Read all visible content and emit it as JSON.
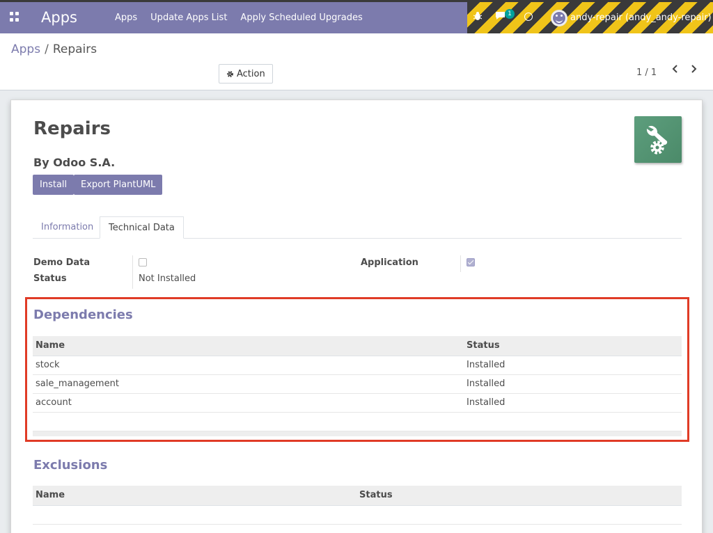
{
  "navbar": {
    "brand": "Apps",
    "menu": [
      "Apps",
      "Update Apps List",
      "Apply Scheduled Upgrades"
    ],
    "chat_badge": "1",
    "user": "andy-repair (andy_andy-repair)"
  },
  "breadcrumb": {
    "parent": "Apps",
    "separator": "/",
    "current": "Repairs"
  },
  "toolbar": {
    "action_label": "Action"
  },
  "pager": {
    "value": "1 / 1"
  },
  "app": {
    "title": "Repairs",
    "author": "By Odoo S.A.",
    "install_label": "Install",
    "export_label": "Export PlantUML"
  },
  "tabs": [
    "Information",
    "Technical Data"
  ],
  "fields": {
    "demo_data_label": "Demo Data",
    "demo_data_checked": false,
    "status_label": "Status",
    "status_value": "Not Installed",
    "application_label": "Application",
    "application_checked": true
  },
  "dependencies": {
    "title": "Dependencies",
    "columns": [
      "Name",
      "Status"
    ],
    "rows": [
      {
        "name": "stock",
        "status": "Installed"
      },
      {
        "name": "sale_management",
        "status": "Installed"
      },
      {
        "name": "account",
        "status": "Installed"
      }
    ]
  },
  "exclusions": {
    "title": "Exclusions",
    "columns": [
      "Name",
      "Status"
    ]
  },
  "colors": {
    "brand": "#7c7bad",
    "highlight": "#e03b26",
    "app_icon": "#5d9e7d"
  }
}
